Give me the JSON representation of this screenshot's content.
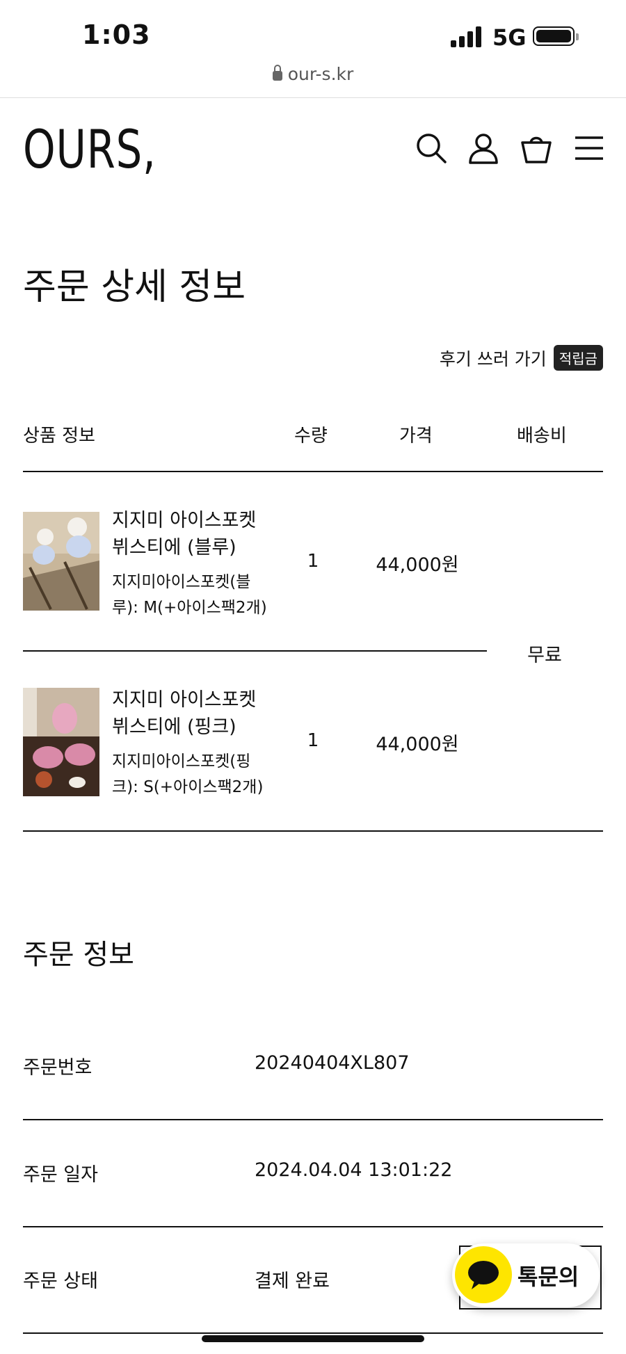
{
  "status_bar": {
    "time": "1:03",
    "network": "5G"
  },
  "browser": {
    "url": "our-s.kr"
  },
  "header": {
    "logo": "OURS,",
    "icons": [
      "search-icon",
      "user-icon",
      "cart-icon",
      "menu-icon"
    ]
  },
  "page": {
    "title": "주문 상세 정보",
    "review_link": "후기 쓰러 가기",
    "review_badge": "적립금"
  },
  "table": {
    "headers": {
      "product": "상품 정보",
      "qty": "수량",
      "price": "가격",
      "shipping": "배송비"
    },
    "shipping_value": "무료",
    "items": [
      {
        "name": "지지미 아이스포켓 뷔스티에 (블루)",
        "option": "지지미아이스포켓(블루): M(+아이스팩2개)",
        "qty": "1",
        "price": "44,000원"
      },
      {
        "name": "지지미 아이스포켓 뷔스티에 (핑크)",
        "option": "지지미아이스포켓(핑크): S(+아이스팩2개)",
        "qty": "1",
        "price": "44,000원"
      }
    ]
  },
  "order_info": {
    "title": "주문 정보",
    "rows": [
      {
        "label": "주문번호",
        "value": "20240404XL807"
      },
      {
        "label": "주문 일자",
        "value": "2024.04.04 13:01:22"
      },
      {
        "label": "주문 상태",
        "value": "결제 완료"
      }
    ]
  },
  "chat": {
    "label": "톡문의"
  },
  "colors": {
    "kakao_yellow": "#FEE500",
    "text": "#111111",
    "badge_bg": "#222222"
  }
}
